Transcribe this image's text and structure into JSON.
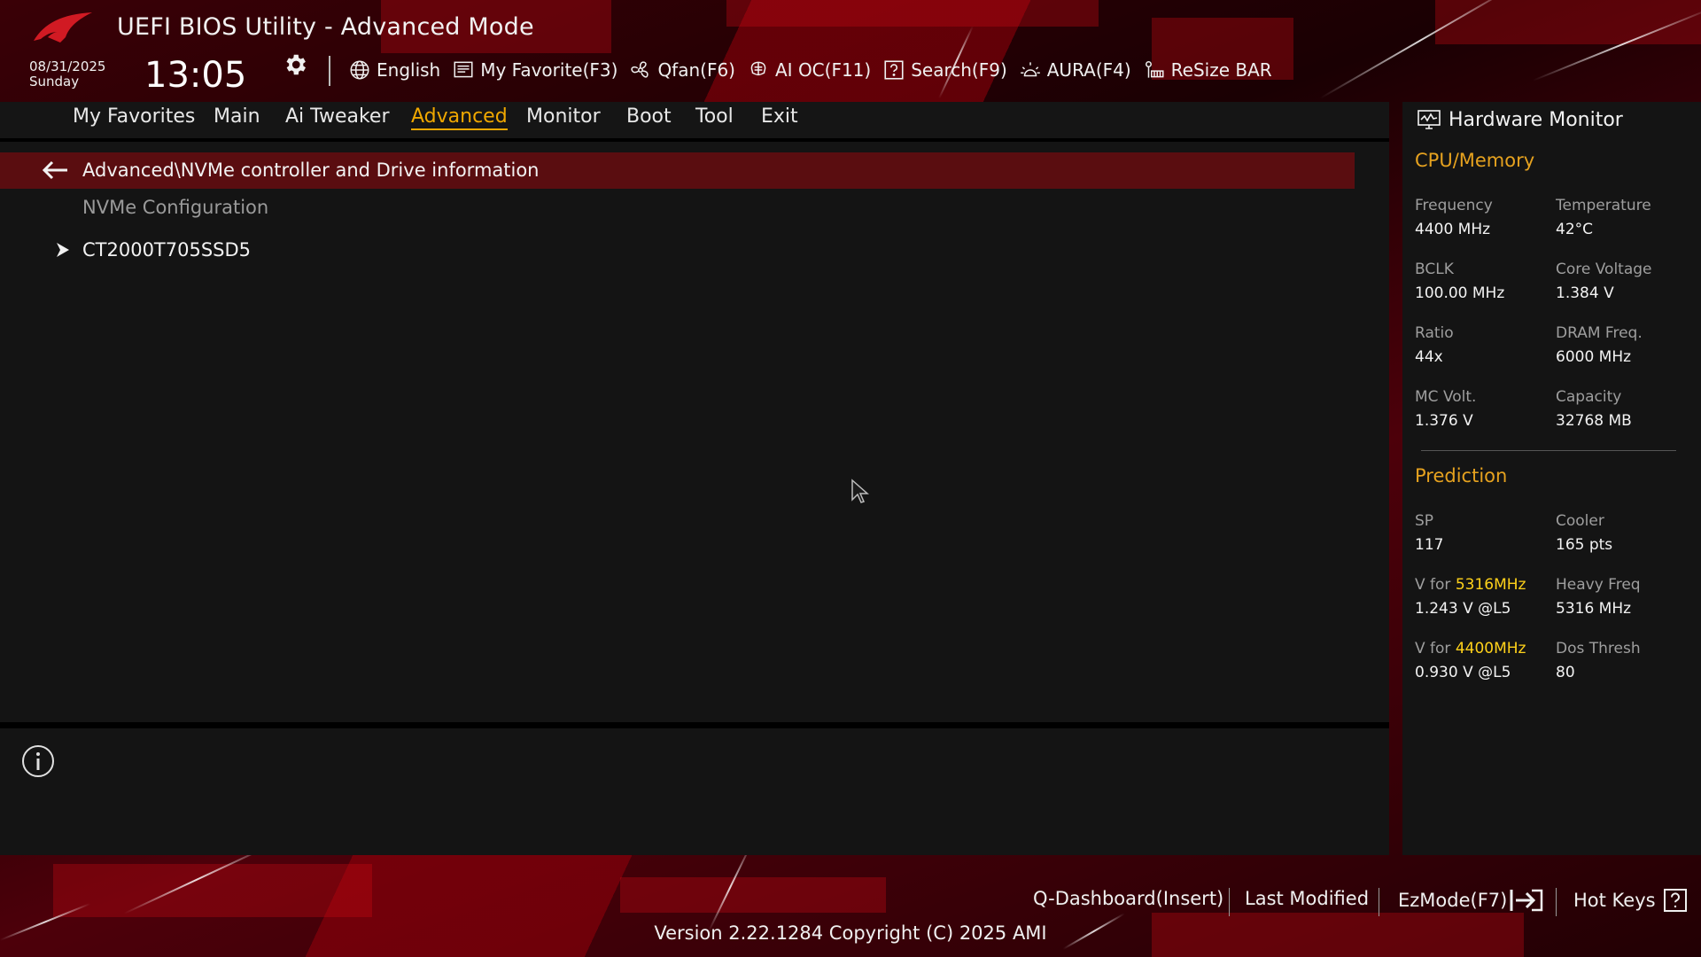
{
  "header": {
    "app_title": "UEFI BIOS Utility - Advanced Mode",
    "date": "08/31/2025",
    "weekday": "Sunday",
    "time": "13:05"
  },
  "toolbar": [
    {
      "label": "English",
      "icon": "globe-icon"
    },
    {
      "label": "My Favorite(F3)",
      "icon": "favorite-list-icon"
    },
    {
      "label": "Qfan(F6)",
      "icon": "fan-icon"
    },
    {
      "label": "AI OC(F11)",
      "icon": "ai-oc-icon"
    },
    {
      "label": "Search(F9)",
      "icon": "search-help-icon"
    },
    {
      "label": "AURA(F4)",
      "icon": "aura-icon"
    },
    {
      "label": "ReSize BAR",
      "icon": "resize-bar-icon"
    }
  ],
  "tabs": [
    {
      "label": "My Favorites"
    },
    {
      "label": "Main"
    },
    {
      "label": "Ai Tweaker"
    },
    {
      "label": "Advanced",
      "active": true
    },
    {
      "label": "Monitor"
    },
    {
      "label": "Boot"
    },
    {
      "label": "Tool"
    },
    {
      "label": "Exit"
    }
  ],
  "main": {
    "breadcrumb": "Advanced\\NVMe controller and Drive information",
    "section_label": "NVMe Configuration",
    "items": [
      {
        "label": "CT2000T705SSD5"
      }
    ]
  },
  "hardware_monitor": {
    "title": "Hardware Monitor",
    "cpu_memory": {
      "title": "CPU/Memory",
      "rows": [
        [
          {
            "label": "Frequency",
            "value": "4400 MHz"
          },
          {
            "label": "Temperature",
            "value": "42°C"
          }
        ],
        [
          {
            "label": "BCLK",
            "value": "100.00 MHz"
          },
          {
            "label": "Core Voltage",
            "value": "1.384 V"
          }
        ],
        [
          {
            "label": "Ratio",
            "value": "44x"
          },
          {
            "label": "DRAM Freq.",
            "value": "6000 MHz"
          }
        ],
        [
          {
            "label": "MC Volt.",
            "value": "1.376 V"
          },
          {
            "label": "Capacity",
            "value": "32768 MB"
          }
        ]
      ]
    },
    "prediction": {
      "title": "Prediction",
      "sp_label": "SP",
      "sp_value": "117",
      "cooler_label": "Cooler",
      "cooler_value": "165 pts",
      "vfor1_prefix": "V for ",
      "vfor1_freq": "5316MHz",
      "vfor1_value": "1.243 V @L5",
      "heavy_label": "Heavy Freq",
      "heavy_value": "5316 MHz",
      "vfor2_prefix": "V for ",
      "vfor2_freq": "4400MHz",
      "vfor2_value": "0.930 V @L5",
      "dos_label": "Dos Thresh",
      "dos_value": "80"
    }
  },
  "footer": {
    "qdashboard": "Q-Dashboard(Insert)",
    "last_modified": "Last Modified",
    "ezmode": "EzMode(F7)",
    "hotkeys": "Hot Keys",
    "version": "Version 2.22.1284 Copyright (C) 2025 AMI"
  },
  "colors": {
    "accent": "#f0a800",
    "highlight": "#ffd21a",
    "breadcrumb_bg": "#5a0d10",
    "panel_bg": "#141414"
  }
}
